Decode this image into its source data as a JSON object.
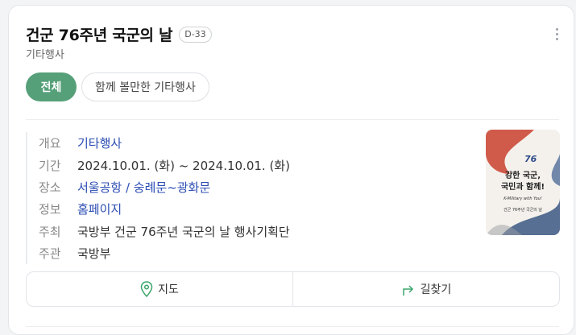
{
  "event": {
    "title": "건군 76주년 국군의 날",
    "dday": "D-33",
    "category": "기타행사"
  },
  "chips": [
    {
      "label": "전체",
      "active": true
    },
    {
      "label": "함께 볼만한 기타행사",
      "active": false
    }
  ],
  "info": [
    {
      "label": "개요",
      "value": "기타행사",
      "link": true
    },
    {
      "label": "기간",
      "value": "2024.10.01. (화) ~  2024.10.01. (화)",
      "link": false
    },
    {
      "label": "장소",
      "value": "서울공항 / 숭례문~광화문",
      "link": true
    },
    {
      "label": "정보",
      "value": "홈페이지",
      "link": true
    },
    {
      "label": "주최",
      "value": "국방부 건군 76주년 국군의 날 행사기획단",
      "link": false
    },
    {
      "label": "주관",
      "value": "국방부",
      "link": false
    }
  ],
  "poster": {
    "line1": "강한 국군,",
    "line2": "국민과 함께!",
    "line3": "K-Military with You!",
    "line4": "건군 76주년 국군의 날",
    "number": "76"
  },
  "actions": {
    "map": "지도",
    "directions": "길찾기"
  },
  "colors": {
    "accent": "#56a079",
    "link": "#2b4cb3"
  }
}
